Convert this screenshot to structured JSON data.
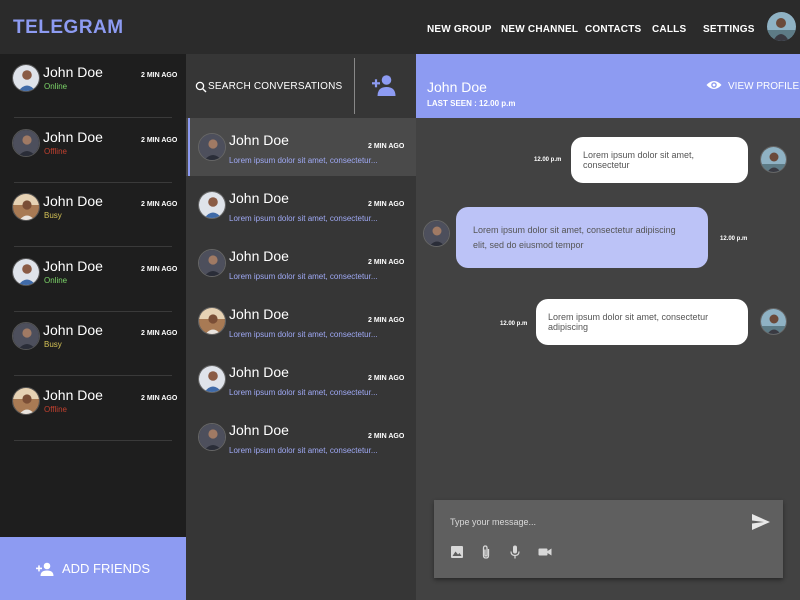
{
  "app": {
    "brand": "TELEGRAM",
    "accent": "#8d9bf2"
  },
  "nav": {
    "items": [
      {
        "id": "new-group",
        "label": "NEW GROUP"
      },
      {
        "id": "new-channel",
        "label": "NEW CHANNEL"
      },
      {
        "id": "contacts",
        "label": "CONTACTS"
      },
      {
        "id": "calls",
        "label": "CALLS"
      },
      {
        "id": "settings",
        "label": "SETTINGS"
      }
    ],
    "avatar_icon": "user-avatar-icon"
  },
  "friends": {
    "items": [
      {
        "name": "John Doe",
        "status": "Online",
        "status_color": "#7bd468",
        "time": "2 MIN AGO",
        "avatar": "man-blue-shirt"
      },
      {
        "name": "John Doe",
        "status": "Offline",
        "status_color": "#c0402f",
        "time": "2 MIN AGO",
        "avatar": "man-dark"
      },
      {
        "name": "John Doe",
        "status": "Busy",
        "status_color": "#d4c256",
        "time": "2 MIN AGO",
        "avatar": "man-outdoor"
      },
      {
        "name": "John Doe",
        "status": "Online",
        "status_color": "#7bd468",
        "time": "2 MIN AGO",
        "avatar": "man-blue-shirt"
      },
      {
        "name": "John Doe",
        "status": "Busy",
        "status_color": "#d4c256",
        "time": "2 MIN AGO",
        "avatar": "man-dark"
      },
      {
        "name": "John Doe",
        "status": "Offline",
        "status_color": "#c0402f",
        "time": "2 MIN AGO",
        "avatar": "man-outdoor"
      }
    ],
    "add_label": "ADD FRIENDS"
  },
  "conversations": {
    "search_label": "SEARCH CONVERSATIONS",
    "items": [
      {
        "name": "John Doe",
        "time": "2 MIN AGO",
        "preview": "Lorem ipsum dolor sit amet, consectetur...",
        "active": true,
        "avatar": "man-dark"
      },
      {
        "name": "John Doe",
        "time": "2 MIN AGO",
        "preview": "Lorem ipsum dolor sit amet, consectetur...",
        "active": false,
        "avatar": "man-blue-shirt"
      },
      {
        "name": "John Doe",
        "time": "2 MIN AGO",
        "preview": "Lorem ipsum dolor sit amet, consectetur...",
        "active": false,
        "avatar": "man-dark"
      },
      {
        "name": "John Doe",
        "time": "2 MIN AGO",
        "preview": "Lorem ipsum dolor sit amet, consectetur...",
        "active": false,
        "avatar": "man-outdoor"
      },
      {
        "name": "John Doe",
        "time": "2 MIN AGO",
        "preview": "Lorem ipsum dolor sit amet, consectetur...",
        "active": false,
        "avatar": "man-blue-shirt"
      },
      {
        "name": "John Doe",
        "time": "2 MIN AGO",
        "preview": "Lorem ipsum dolor sit amet, consectetur...",
        "active": false,
        "avatar": "man-dark"
      }
    ]
  },
  "chat": {
    "name": "John Doe",
    "last_seen": "LAST SEEN : 12.00 p.m",
    "view_profile": "VIEW PROFILE",
    "messages": [
      {
        "direction": "out",
        "text": "Lorem ipsum dolor sit amet, consectetur",
        "time": "12.00 p.m"
      },
      {
        "direction": "in",
        "text": "Lorem ipsum dolor sit amet, consectetur adipiscing elit, sed do eiusmod tempor",
        "time": "12.00 p.m"
      },
      {
        "direction": "out",
        "text": "Lorem ipsum dolor sit amet, consectetur adipiscing",
        "time": "12.00 p.m"
      }
    ],
    "composer_placeholder": "Type your message...",
    "tools": [
      "image-icon",
      "attachment-icon",
      "microphone-icon",
      "video-icon"
    ]
  }
}
